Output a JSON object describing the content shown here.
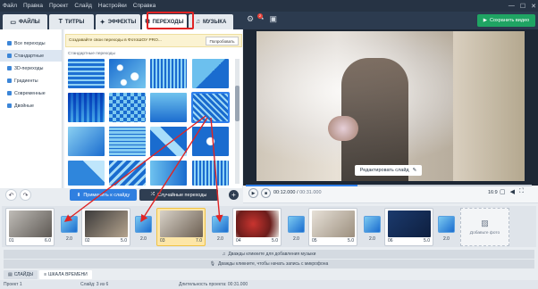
{
  "menu": [
    "Файл",
    "Правка",
    "Проект",
    "Слайд",
    "Настройки",
    "Справка"
  ],
  "window_controls": [
    "—",
    "☐",
    "✕"
  ],
  "tabs": [
    {
      "label": "ФАЙЛЫ",
      "icon": "folder-icon"
    },
    {
      "label": "ТИТРЫ",
      "icon": "text-icon"
    },
    {
      "label": "ЭФФЕКТЫ",
      "icon": "effects-icon"
    },
    {
      "label": "ПЕРЕХОДЫ",
      "icon": "transitions-icon"
    },
    {
      "label": "МУЗЫКА",
      "icon": "music-icon"
    }
  ],
  "notification_count": "2",
  "save_button": "Сохранить видео",
  "sidebar": [
    {
      "label": "Все переходы"
    },
    {
      "label": "Стандартные"
    },
    {
      "label": "3D-переходы"
    },
    {
      "label": "Градиенты"
    },
    {
      "label": "Современные"
    },
    {
      "label": "Двойные"
    }
  ],
  "promo": {
    "text": "Создавайте свои переходы в ФотоШОУ PRO...",
    "button": "Попробовать"
  },
  "section_title": "Стандартные переходы",
  "apply_button": "Применить к слайду",
  "random_button": "Случайные переходы",
  "edit_slide": "Редактировать слайд",
  "player": {
    "current": "00:12.000",
    "total": "00:31.000",
    "progress": 0.39,
    "ratio": "16:9"
  },
  "slides": [
    {
      "num": "01",
      "dur": "6.0"
    },
    {
      "num": "02",
      "dur": "5.0"
    },
    {
      "num": "03",
      "dur": "7.0"
    },
    {
      "num": "04",
      "dur": "5.0"
    },
    {
      "num": "05",
      "dur": "5.0"
    },
    {
      "num": "06",
      "dur": "5.0"
    }
  ],
  "transitions": [
    "2.0",
    "2.0",
    "2.0",
    "2.0",
    "2.0",
    "2.0"
  ],
  "add_photo": "Добавьте фото",
  "music_hint": "Дважды кликните для добавления музыки",
  "mic_hint": "Дважды кликните, чтобы начать запись с микрофона",
  "bottom_tabs": [
    "СЛАЙДЫ",
    "ШКАЛА ВРЕМЕНИ"
  ],
  "status": {
    "project": "Проект 1",
    "slide": "Слайд: 3 из 6",
    "duration": "Длительность проекта: 00:31.000"
  },
  "colors": {
    "accent": "#2f80ed",
    "highlight": "#e02424",
    "save": "#1fa463"
  }
}
